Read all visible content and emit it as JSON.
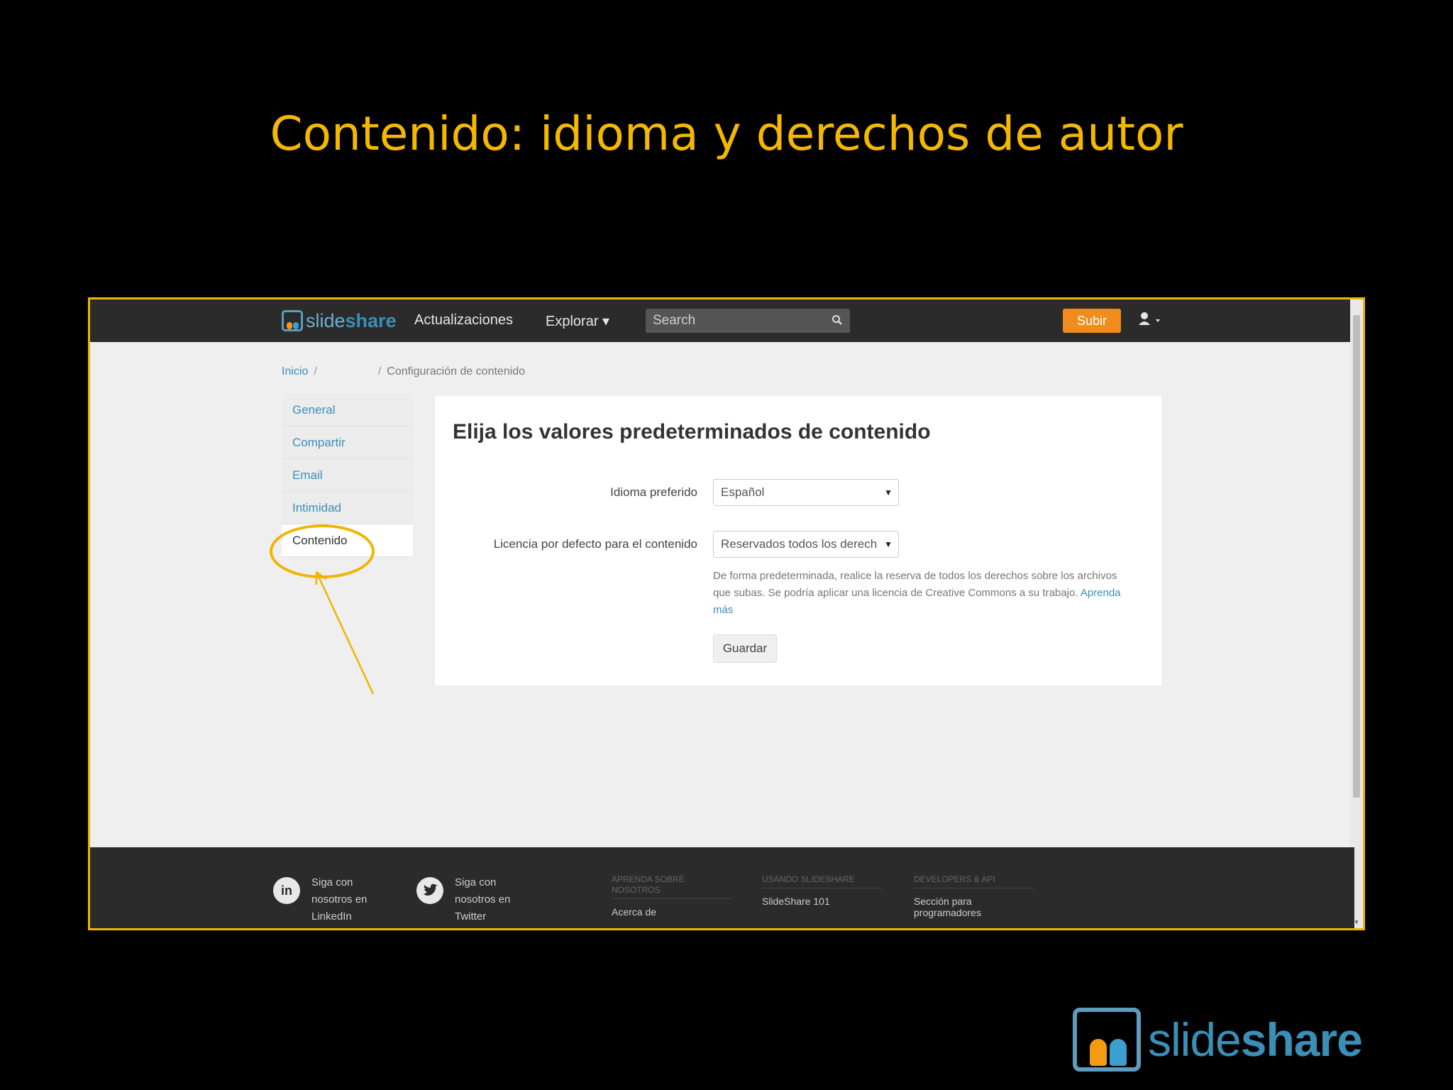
{
  "slide": {
    "title": "Contenido: idioma y derechos de autor",
    "accent_color": "#f1b400"
  },
  "topbar": {
    "logo_light": "slide",
    "logo_bold": "share",
    "updates": "Actualizaciones",
    "explore": "Explorar ▾",
    "search_placeholder": "Search",
    "upload": "Subir",
    "user_menu": "user-icon"
  },
  "breadcrumb": {
    "home": "Inicio",
    "sep": "/",
    "current": "Configuración de contenido"
  },
  "sidebar": {
    "items": [
      {
        "label": "General"
      },
      {
        "label": "Compartir"
      },
      {
        "label": "Email"
      },
      {
        "label": "Intimidad"
      },
      {
        "label": "Contenido"
      }
    ]
  },
  "panel": {
    "title": "Elija los valores predeterminados de contenido",
    "language_label": "Idioma preferido",
    "language_value": "Español",
    "license_label": "Licencia por defecto para el contenido",
    "license_value": "Reservados todos los derech",
    "help_text": "De forma predeterminada, realice la reserva de todos los derechos sobre los archivos que subas. Se podría aplicar una licencia de Creative Commons a su trabajo.",
    "help_link": "Aprenda más",
    "save": "Guardar"
  },
  "footer": {
    "linkedin_glyph": "in",
    "linkedin_text": "Siga con nosotros en LinkedIn",
    "twitter_text": "Siga con nosotros en Twitter",
    "col1_head": "APRENDA SOBRE NOSOTROS",
    "col1_link": "Acerca de",
    "col2_head": "USANDO SLIDESHARE",
    "col2_link": "SlideShare 101",
    "col3_head": "DEVELOPERS & API",
    "col3_link": "Sección para programadores"
  },
  "brand": {
    "light": "slide",
    "bold": "share"
  }
}
